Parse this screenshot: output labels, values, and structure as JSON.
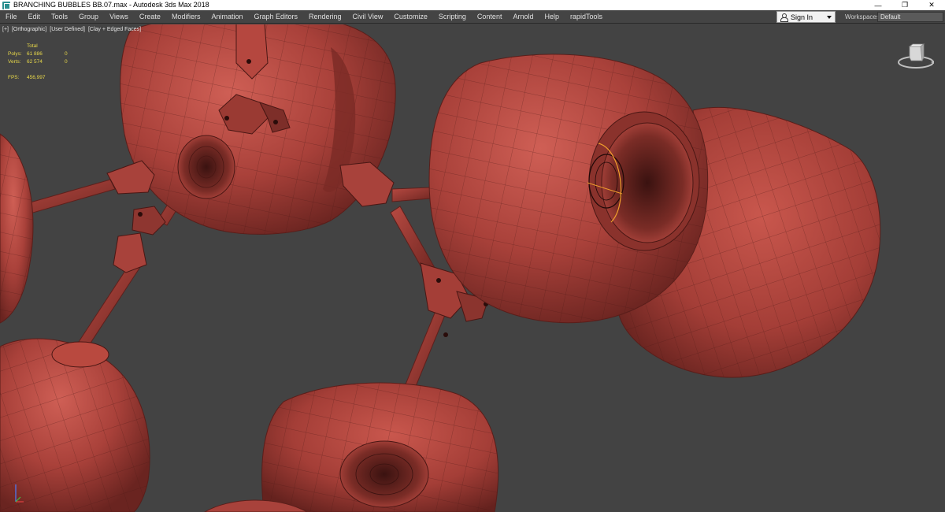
{
  "window": {
    "title": "BRANCHING BUBBLES BB.07.max - Autodesk 3ds Max 2018",
    "controls": [
      "—",
      "❐",
      "✕"
    ]
  },
  "menu": {
    "items": [
      "File",
      "Edit",
      "Tools",
      "Group",
      "Views",
      "Create",
      "Modifiers",
      "Animation",
      "Graph Editors",
      "Rendering",
      "Civil View",
      "Customize",
      "Scripting",
      "Content",
      "Arnold",
      "Help",
      "rapidTools"
    ],
    "sign_in": "Sign In",
    "workspaces_label": "Workspaces:",
    "workspaces_value": "Default"
  },
  "viewport": {
    "labels": [
      "[+]",
      "[Orthographic]",
      "[User Defined]",
      "[Clay + Edged Faces]"
    ],
    "stats": {
      "total_header": "Total",
      "polys_label": "Polys:",
      "polys_total": "61 886",
      "polys_sel": "0",
      "verts_label": "Verts:",
      "verts_total": "62 574",
      "verts_sel": "0",
      "fps_label": "FPS:",
      "fps_value": "456,997"
    }
  },
  "colors": {
    "clay": "#a9413a",
    "clay_dark": "#6e2621",
    "clay_light": "#cc5c53",
    "background": "#434343",
    "stats_text": "#e8d84a",
    "highlight": "#f1a02c"
  },
  "icons": [
    "app-icon",
    "user-icon",
    "dropdown-caret-icon",
    "viewcube-icon",
    "axis-tripod-icon"
  ]
}
